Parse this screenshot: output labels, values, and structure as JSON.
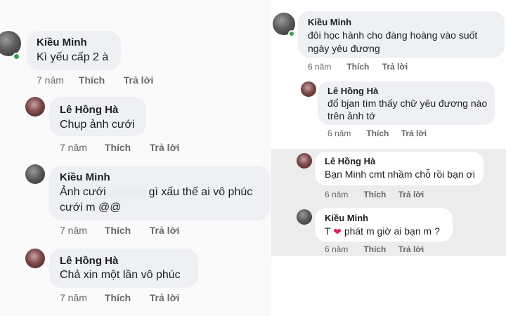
{
  "left": {
    "comments": [
      {
        "author": "Kiều Minh",
        "text": "Kì yếu cấp 2 à",
        "time": "7 năm",
        "like": "Thích",
        "reply": "Trả lời"
      },
      {
        "author": "Lê Hồng Hà",
        "text": "Chụp ảnh cưới",
        "time": "7 năm",
        "like": "Thích",
        "reply": "Trả lời"
      },
      {
        "author": "Kiều Minh",
        "text_before": "Ảnh cưới",
        "text_after": "gì xấu thế ai vô phúc",
        "text_line2": "cưới m @@",
        "time": "7 năm",
        "like": "Thích",
        "reply": "Trả lời"
      },
      {
        "author": "Lê Hồng Hà",
        "text": "Chả xin một lần vô phúc",
        "time": "7 năm",
        "like": "Thích",
        "reply": "Trả lời"
      }
    ]
  },
  "right": {
    "comments": [
      {
        "author": "Kiều Minh",
        "text_line1": "đôi    học hành cho đàng hoàng vào suốt",
        "text_line2": "ngày yêu đương",
        "time": "6 năm",
        "like": "Thích",
        "reply": "Trả lời"
      },
      {
        "author": "Lê Hồng Hà",
        "text_line1": "đổ bjan tìm thấy chữ yêu đương nào",
        "text_line2": "trên ảnh tớ",
        "time": "6 năm",
        "like": "Thích",
        "reply": "Trả lời"
      },
      {
        "author": "Lê Hồng Hà",
        "text": "Bạn Minh cmt nhầm chỗ rồi bạn ơi",
        "time": "6 năm",
        "like": "Thích",
        "reply": "Trả lời"
      },
      {
        "author": "Kiều Minh",
        "text_before": "T",
        "text_after": "phát m giờ ai bạn m ?",
        "time": "6 năm",
        "like": "Thích",
        "reply": "Trả lời"
      }
    ]
  },
  "colors": {
    "bubble": "#eef0f3",
    "muted": "#65676b",
    "online": "#31a24c",
    "heart": "#e0245e"
  },
  "icons": {
    "online": "online-status-dot",
    "heart": "heart-icon"
  }
}
